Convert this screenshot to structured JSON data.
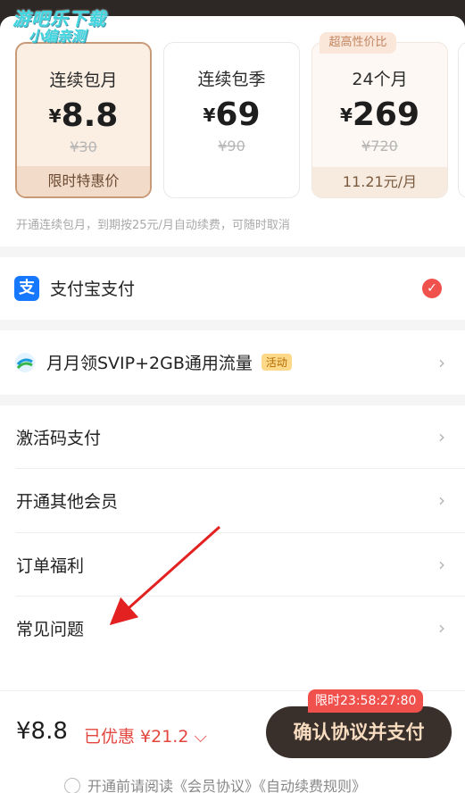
{
  "watermark": {
    "line1": "游吧乐下载",
    "line2": "小编亲测"
  },
  "plans": [
    {
      "name": "连续包月",
      "currency": "¥",
      "price": "8.8",
      "original": "¥30",
      "footer": "限时特惠价",
      "selected": true
    },
    {
      "name": "连续包季",
      "currency": "¥",
      "price": "69",
      "original": "¥90",
      "footer": ""
    },
    {
      "name": "24个月",
      "currency": "¥",
      "price": "269",
      "original": "¥720",
      "footer": "11.21元/月",
      "badge": "超高性价比"
    }
  ],
  "notice": "开通连续包月，到期按25元/月自动续费，可随时取消",
  "payment": {
    "alipay_label": "支付宝支付",
    "alipay_icon": "支"
  },
  "promo": {
    "label": "月月领SVIP+2GB通用流量",
    "tag": "活动"
  },
  "menu": [
    {
      "label": "激活码支付"
    },
    {
      "label": "开通其他会员"
    },
    {
      "label": "订单福利"
    },
    {
      "label": "常见问题"
    }
  ],
  "bottom": {
    "total": "¥8.8",
    "saved": "已优惠 ¥21.2 ⌵",
    "timer": "限时23:58:27:80",
    "pay_button": "确认协议并支付",
    "agreement": "开通前请阅读《会员协议》《自动续费规则》"
  },
  "colors": {
    "accent_red": "#f0514d",
    "alipay_blue": "#1677ff",
    "pay_button": "#3a302b"
  }
}
